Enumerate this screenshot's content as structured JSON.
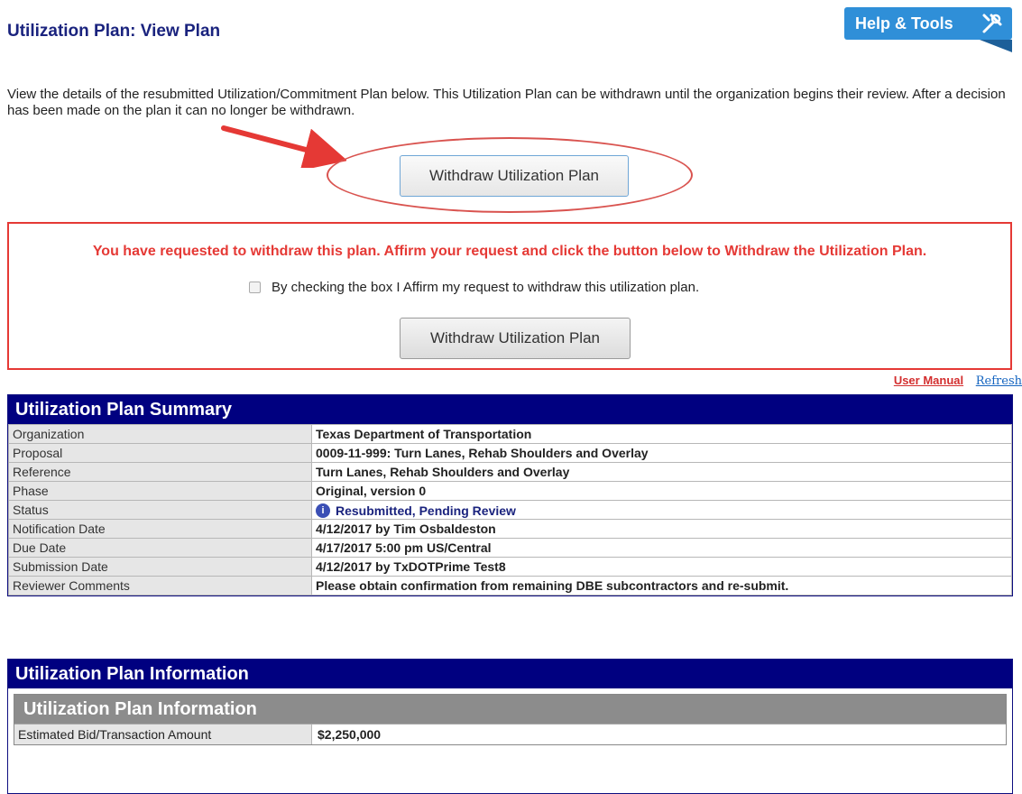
{
  "page": {
    "title": "Utilization Plan: View Plan",
    "help_label": "Help & Tools",
    "intro": "View the details of the resubmitted Utilization/Commitment Plan below. This Utilization Plan can be withdrawn until the organization begins their review. After a decision has been made on the plan it can no longer be withdrawn.",
    "withdraw_button": "Withdraw Utilization Plan"
  },
  "confirm": {
    "message": "You have requested to withdraw this plan. Affirm your request and click the button below to Withdraw the Utilization Plan.",
    "affirm_label": "By checking the box I Affirm my request to withdraw this utilization plan.",
    "affirm_checked": false,
    "withdraw_button": "Withdraw Utilization Plan"
  },
  "links": {
    "user_manual": "User Manual",
    "refresh": "Refresh"
  },
  "summary": {
    "title": "Utilization Plan Summary",
    "rows": [
      {
        "label": "Organization",
        "value": "Texas Department of Transportation"
      },
      {
        "label": "Proposal",
        "value": "0009-11-999: Turn Lanes, Rehab Shoulders and Overlay"
      },
      {
        "label": "Reference",
        "value": "Turn Lanes, Rehab Shoulders and Overlay"
      },
      {
        "label": "Phase",
        "value": "Original, version 0"
      },
      {
        "label": "Status",
        "value": "Resubmitted, Pending Review"
      },
      {
        "label": "Notification Date",
        "value": "4/12/2017 by Tim Osbaldeston"
      },
      {
        "label": "Due Date",
        "value": "4/17/2017 5:00 pm US/Central"
      },
      {
        "label": "Submission Date",
        "value": "4/12/2017 by TxDOTPrime Test8"
      },
      {
        "label": "Reviewer Comments",
        "value": "Please obtain confirmation from remaining DBE subcontractors and re-submit."
      }
    ]
  },
  "information": {
    "title": "Utilization Plan Information",
    "sub_title": "Utilization Plan Information",
    "rows": [
      {
        "label": "Estimated Bid/Transaction Amount",
        "value": "$2,250,000"
      }
    ]
  },
  "colors": {
    "header_navy": "#000080",
    "alert_red": "#e53935",
    "help_blue": "#2f8fd8"
  },
  "icons": [
    "tools-icon",
    "arrow-annotation",
    "info-icon"
  ]
}
